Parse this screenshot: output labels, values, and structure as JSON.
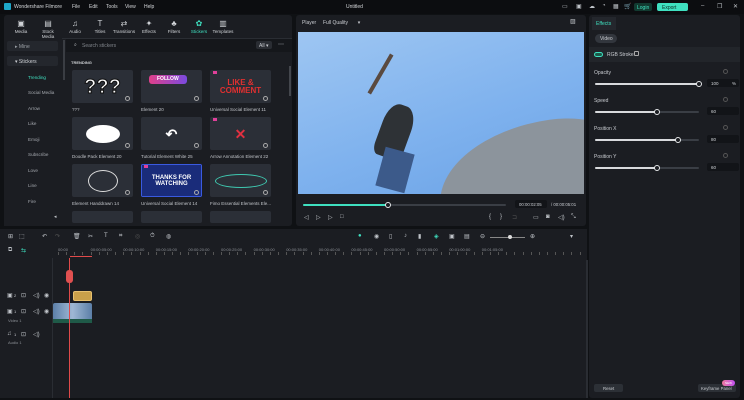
{
  "app": {
    "title": "Wondershare Filmore",
    "project": "Untitled",
    "menu": [
      "File",
      "Edit",
      "Tools",
      "View",
      "Help"
    ],
    "login": "Login",
    "export": "Export",
    "accent": "#3fe0c0"
  },
  "toolbar": [
    {
      "label": "Media",
      "icon": "media-icon"
    },
    {
      "label": "Stock Media",
      "icon": "stock-media-icon"
    },
    {
      "label": "Audio",
      "icon": "music-icon"
    },
    {
      "label": "Titles",
      "icon": "titles-icon"
    },
    {
      "label": "Transitions",
      "icon": "transitions-icon"
    },
    {
      "label": "Effects",
      "icon": "effects-icon"
    },
    {
      "label": "Filters",
      "icon": "filters-icon"
    },
    {
      "label": "Stickers",
      "icon": "stickers-icon",
      "active": true
    },
    {
      "label": "Templates",
      "icon": "templates-icon"
    }
  ],
  "sidebar": {
    "sections": [
      "Mine",
      "Stickers"
    ],
    "items": [
      "Trending",
      "Social Media",
      "Arrow",
      "Like",
      "Emoji",
      "Subscribe",
      "Love",
      "Line",
      "Fire"
    ],
    "active": "Trending"
  },
  "search": {
    "placeholder": "Search stickers",
    "filter": "All"
  },
  "section_title": "TRENDING",
  "stickers": [
    {
      "label": "???",
      "art": "???"
    },
    {
      "label": "Element 20",
      "art": "FOLLOW"
    },
    {
      "label": "Universal Social Element 11",
      "art": "LIKE & COMMENT"
    },
    {
      "label": "Doodle Pack Element 20",
      "art": ""
    },
    {
      "label": "Tutorial Element White 25",
      "art": "↶"
    },
    {
      "label": "Arrow Annotation Element 22",
      "art": "✕"
    },
    {
      "label": "Element Handdrawn 14",
      "art": ""
    },
    {
      "label": "Universal Social Element 14",
      "art": "THANKS FOR WATCHING"
    },
    {
      "label": "Fimo Essential Elements Ele...",
      "art": ""
    }
  ],
  "player": {
    "label": "Player",
    "quality": "Full Quality",
    "current": "00:00:02:05",
    "total": "/ 00:00:05:01",
    "progress": 0.42
  },
  "effects": {
    "tab": "Effects",
    "subtab": "Video",
    "effect_name": "RGB Stroke",
    "enabled": true,
    "params": [
      {
        "label": "Opacity",
        "value": "100",
        "unit": "%",
        "fraction": 1.0
      },
      {
        "label": "Speed",
        "value": "60",
        "unit": "",
        "fraction": 0.6
      },
      {
        "label": "Position X",
        "value": "80",
        "unit": "",
        "fraction": 0.8
      },
      {
        "label": "Position Y",
        "value": "60",
        "unit": "",
        "fraction": 0.6
      }
    ],
    "reset": "Reset",
    "keyframe": "Keyframe Panel",
    "badge": "NEW"
  },
  "timeline": {
    "ruler": [
      "00:00",
      "00:00:05:00",
      "00:00:10:00",
      "00:00:15:00",
      "00:00:20:00",
      "00:00:25:00",
      "00:00:30:00",
      "00:00:35:00",
      "00:00:40:00",
      "00:00:45:00",
      "00:00:50:00",
      "00:00:55:00",
      "00:01:00:00",
      "00:01:05:00"
    ],
    "tracks": [
      {
        "num": "2",
        "name": ""
      },
      {
        "num": "1",
        "name": "Video 1"
      },
      {
        "num": "1",
        "name": "Audio 1"
      }
    ]
  }
}
